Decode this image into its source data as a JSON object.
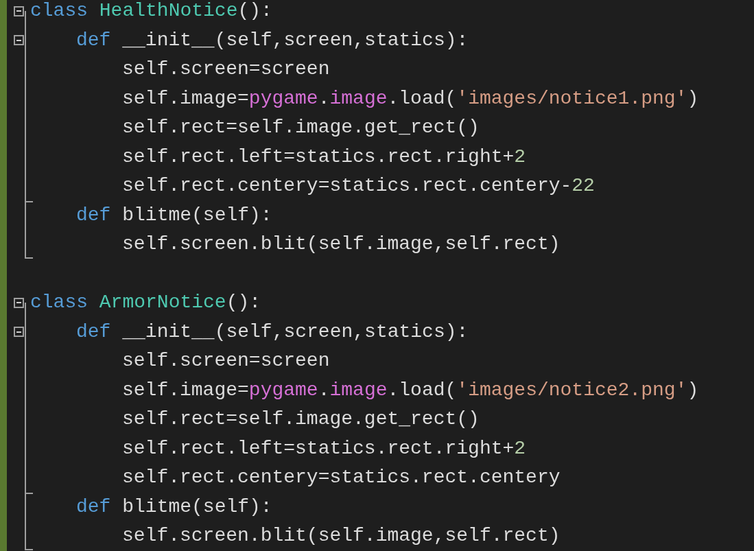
{
  "editor": {
    "classes": [
      {
        "expanded": true,
        "tokens": [
          {
            "kind": "keyword",
            "text": "class"
          },
          {
            "kind": "class",
            "text": " HealthNotice"
          },
          {
            "kind": "plain",
            "text": "():"
          }
        ],
        "children": [
          {
            "expanded": true,
            "tokens": [
              {
                "kind": "keyword",
                "text": "def"
              },
              {
                "kind": "plain",
                "text": " __init__(self,screen,statics):"
              }
            ],
            "children": [
              {
                "tokens": [
                  {
                    "kind": "plain",
                    "text": "self.screen=screen"
                  }
                ]
              },
              {
                "tokens": [
                  {
                    "kind": "plain",
                    "text": "self.image="
                  },
                  {
                    "kind": "module",
                    "text": "pygame"
                  },
                  {
                    "kind": "plain",
                    "text": "."
                  },
                  {
                    "kind": "module",
                    "text": "image"
                  },
                  {
                    "kind": "plain",
                    "text": ".load("
                  },
                  {
                    "kind": "string",
                    "text": "'images/notice1.png'"
                  },
                  {
                    "kind": "plain",
                    "text": ")"
                  }
                ]
              },
              {
                "tokens": [
                  {
                    "kind": "plain",
                    "text": "self.rect=self.image.get_rect()"
                  }
                ]
              },
              {
                "tokens": [
                  {
                    "kind": "plain",
                    "text": "self.rect.left=statics.rect.right+"
                  },
                  {
                    "kind": "number",
                    "text": "2"
                  }
                ]
              },
              {
                "tokens": [
                  {
                    "kind": "plain",
                    "text": "self.rect.centery=statics.rect.centery-"
                  },
                  {
                    "kind": "number",
                    "text": "22"
                  }
                ]
              }
            ]
          },
          {
            "tokens": [
              {
                "kind": "keyword",
                "text": "def"
              },
              {
                "kind": "plain",
                "text": " blitme(self):"
              }
            ],
            "children": [
              {
                "tokens": [
                  {
                    "kind": "plain",
                    "text": "self.screen.blit(self.image,self.rect)"
                  }
                ]
              }
            ]
          }
        ]
      },
      {
        "expanded": true,
        "tokens": [
          {
            "kind": "keyword",
            "text": "class"
          },
          {
            "kind": "class",
            "text": " ArmorNotice"
          },
          {
            "kind": "plain",
            "text": "():"
          }
        ],
        "children": [
          {
            "expanded": true,
            "tokens": [
              {
                "kind": "keyword",
                "text": "def"
              },
              {
                "kind": "plain",
                "text": " __init__(self,screen,statics):"
              }
            ],
            "children": [
              {
                "tokens": [
                  {
                    "kind": "plain",
                    "text": "self.screen=screen"
                  }
                ]
              },
              {
                "tokens": [
                  {
                    "kind": "plain",
                    "text": "self.image="
                  },
                  {
                    "kind": "module",
                    "text": "pygame"
                  },
                  {
                    "kind": "plain",
                    "text": "."
                  },
                  {
                    "kind": "module",
                    "text": "image"
                  },
                  {
                    "kind": "plain",
                    "text": ".load("
                  },
                  {
                    "kind": "string",
                    "text": "'images/notice2.png'"
                  },
                  {
                    "kind": "plain",
                    "text": ")"
                  }
                ]
              },
              {
                "tokens": [
                  {
                    "kind": "plain",
                    "text": "self.rect=self.image.get_rect()"
                  }
                ]
              },
              {
                "tokens": [
                  {
                    "kind": "plain",
                    "text": "self.rect.left=statics.rect.right+"
                  },
                  {
                    "kind": "number",
                    "text": "2"
                  }
                ]
              },
              {
                "tokens": [
                  {
                    "kind": "plain",
                    "text": "self.rect.centery=statics.rect.centery"
                  }
                ]
              }
            ]
          },
          {
            "tokens": [
              {
                "kind": "keyword",
                "text": "def"
              },
              {
                "kind": "plain",
                "text": " blitme(self):"
              }
            ],
            "children": [
              {
                "tokens": [
                  {
                    "kind": "plain",
                    "text": "self.screen.blit(self.image,self.rect)"
                  }
                ]
              }
            ]
          }
        ]
      }
    ]
  }
}
